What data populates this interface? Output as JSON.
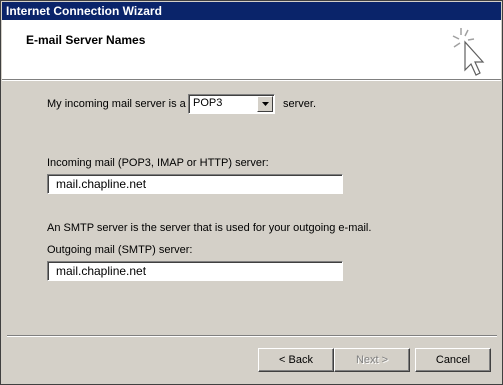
{
  "window": {
    "title": "Internet Connection Wizard"
  },
  "header": {
    "page_title": "E-mail Server Names",
    "icon": "wizard-cursor-sparkle-icon"
  },
  "incoming_type": {
    "label_before": "My incoming mail server is a",
    "selected": "POP3",
    "label_after": "server."
  },
  "incoming_server": {
    "label": "Incoming mail (POP3, IMAP or HTTP) server:",
    "value": "mail.chapline.net"
  },
  "smtp_info": "An SMTP server is the server that is used for your outgoing e-mail.",
  "outgoing_server": {
    "label": "Outgoing mail (SMTP) server:",
    "value": "mail.chapline.net"
  },
  "buttons": {
    "back": "< Back",
    "next": "Next >",
    "cancel": "Cancel"
  },
  "colors": {
    "titlebar": "#0a246a",
    "face": "#d4d0c8"
  }
}
